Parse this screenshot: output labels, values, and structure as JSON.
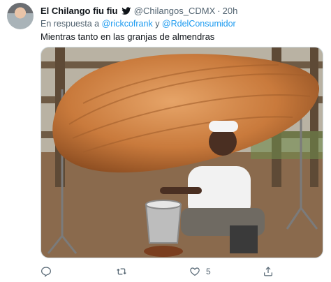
{
  "tweet": {
    "author_name": "El Chilango fiu fiu",
    "handle": "@Chilangos_CDMX",
    "separator": "·",
    "time": "20h",
    "reply_prefix": "En respuesta a",
    "reply_mention_1": "@rickcofrank",
    "reply_joiner": "y",
    "reply_mention_2": "@RdelConsumidor",
    "body": "Mientras tanto en las granjas de almendras",
    "likes": "5"
  },
  "colors": {
    "accent": "#1d9bf0",
    "muted": "#536471",
    "text": "#0f1419"
  },
  "icons": [
    "verified-bird-icon",
    "reply-icon",
    "retweet-icon",
    "like-icon",
    "share-icon"
  ]
}
